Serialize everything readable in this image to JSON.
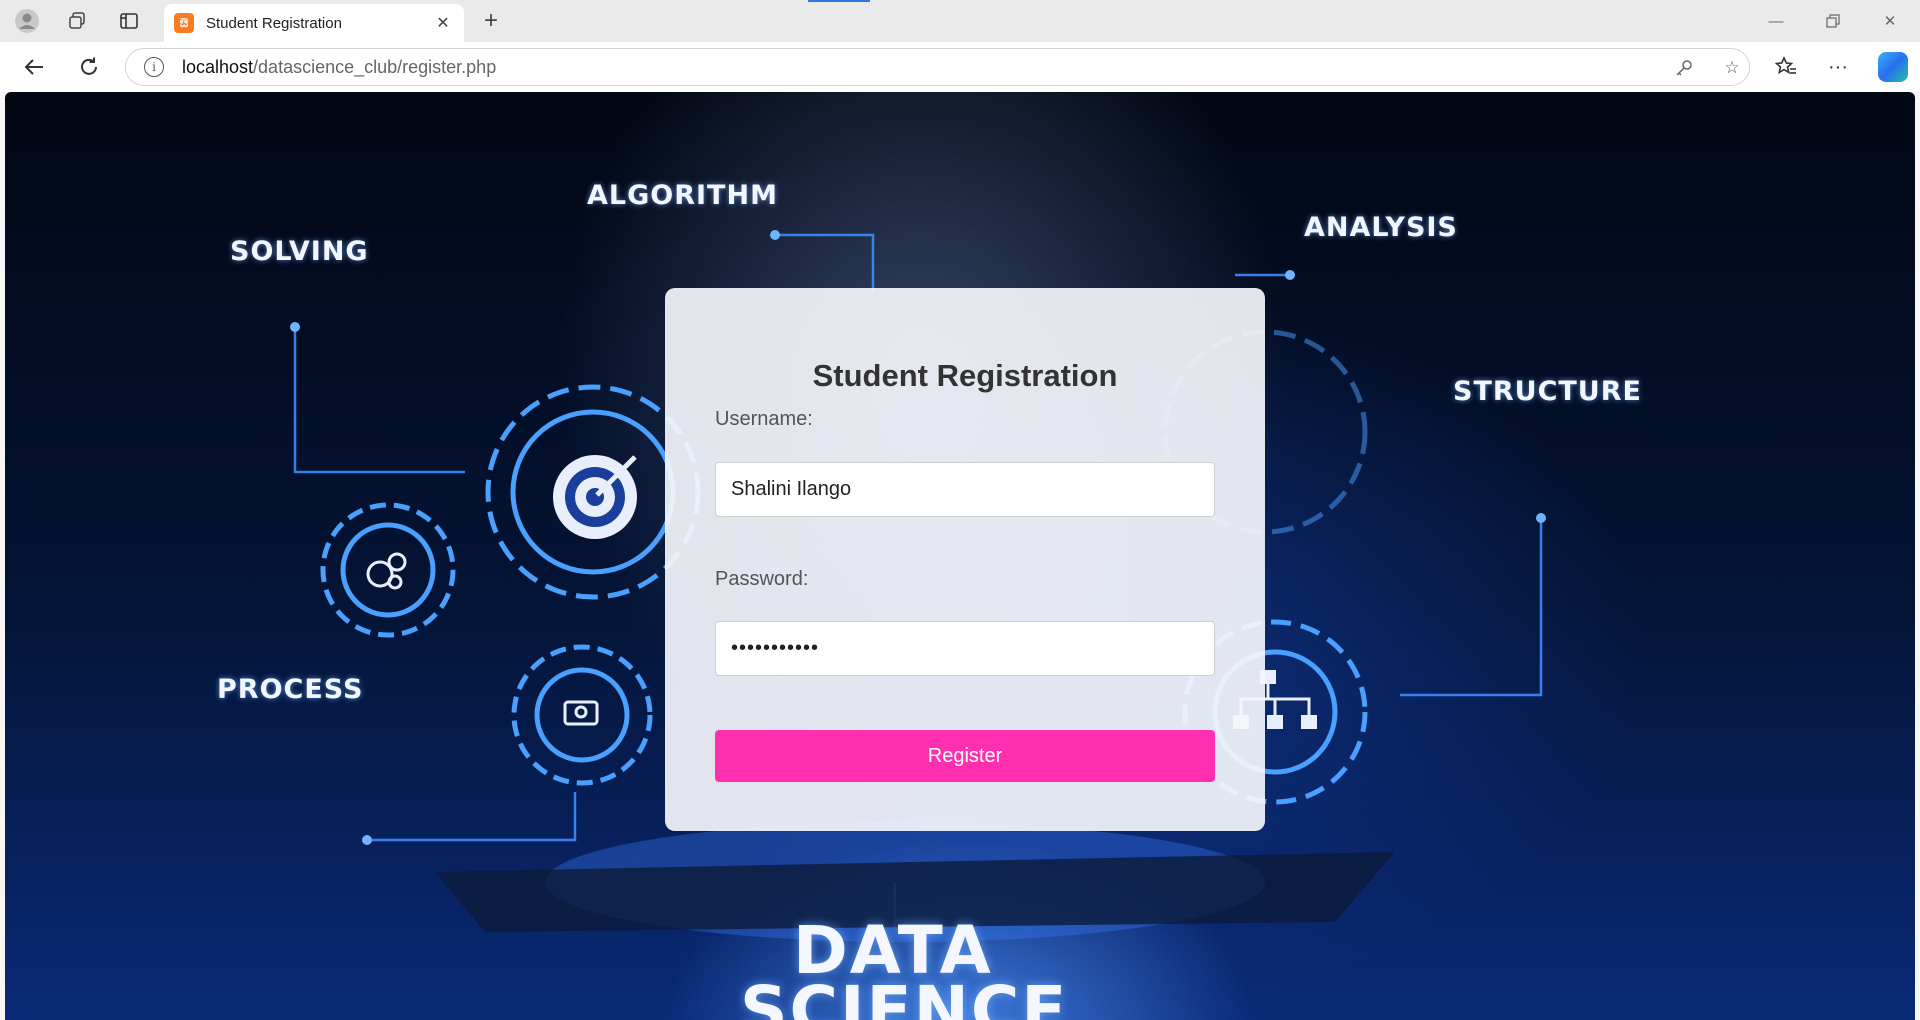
{
  "browser": {
    "tab": {
      "title": "Student Registration",
      "favicon_glyph": "ಔ"
    },
    "url": {
      "host": "localhost",
      "path": "/datascience_club/register.php"
    },
    "icons": {
      "profile": "profile-icon",
      "workspaces": "workspaces-icon",
      "tab_actions": "tab-actions-icon",
      "close": "close-icon",
      "new_tab": "plus-icon",
      "back": "back-arrow-icon",
      "refresh": "refresh-icon",
      "site_info": "info-icon",
      "key": "key-icon",
      "favorite": "star-icon",
      "favorites": "favorites-icon",
      "more": "more-icon",
      "copilot": "copilot-icon"
    }
  },
  "background": {
    "labels": {
      "algorithm": "ALGORITHM",
      "analysis": "ANALYSIS",
      "solving": "SOLVING",
      "structure": "STRUCTURE",
      "process": "PROCESS",
      "data": "DATA",
      "science": "SCIENCE"
    },
    "accent": "#1e6bff"
  },
  "form": {
    "title": "Student Registration",
    "username_label": "Username:",
    "username_value": "Shalini Ilango",
    "password_label": "Password:",
    "password_value": "shalini1234",
    "submit_label": "Register",
    "submit_color": "#ff2fb0"
  }
}
